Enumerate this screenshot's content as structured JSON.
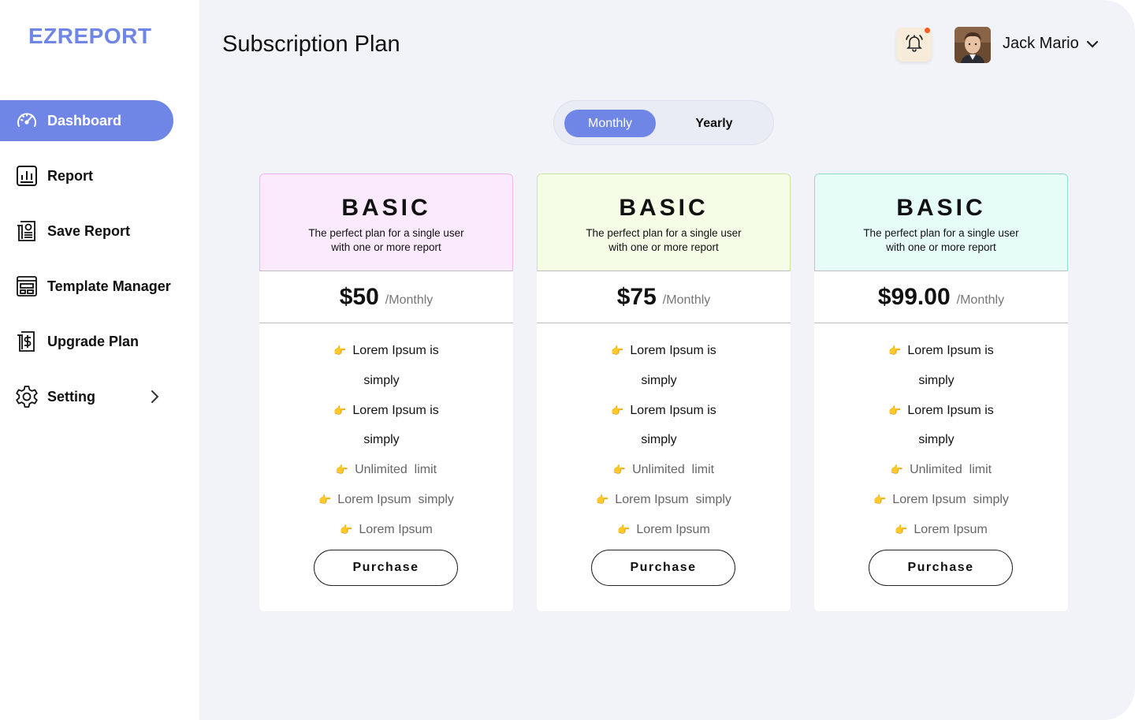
{
  "app": {
    "logo": "EZREPORT"
  },
  "sidebar": {
    "items": [
      {
        "label": "Dashboard",
        "icon": "speedometer-icon",
        "active": true
      },
      {
        "label": "Report",
        "icon": "bar-chart-icon",
        "active": false
      },
      {
        "label": "Save Report",
        "icon": "document-icon",
        "active": false
      },
      {
        "label": "Template Manager",
        "icon": "layout-icon",
        "active": false
      },
      {
        "label": "Upgrade Plan",
        "icon": "dollar-document-icon",
        "active": false
      },
      {
        "label": "Setting",
        "icon": "gear-icon",
        "active": false
      }
    ]
  },
  "header": {
    "title": "Subscription Plan",
    "user_name": "Jack Mario"
  },
  "billing_toggle": {
    "options": [
      "Monthly",
      "Yearly"
    ],
    "selected": "Monthly"
  },
  "plans": [
    {
      "name": "BASIC",
      "description": "The perfect plan for a single user with one or more report",
      "price": "$50",
      "period": "/Monthly",
      "header_bg": "#fbeafd",
      "header_border": "#e9b7ef",
      "features": [
        "Lorem Ipsum is",
        "simply",
        "Lorem Ipsum is",
        "simply",
        "Unlimited  limit",
        "Lorem Ipsum  simply",
        "Lorem Ipsum"
      ],
      "button": "Purchase"
    },
    {
      "name": "BASIC",
      "description": "The perfect plan for a single user with one or more report",
      "price": "$75",
      "period": "/Monthly",
      "header_bg": "#f6fde7",
      "header_border": "#c9e3a0",
      "features": [
        "Lorem Ipsum is",
        "simply",
        "Lorem Ipsum is",
        "simply",
        "Unlimited  limit",
        "Lorem Ipsum  simply",
        "Lorem Ipsum"
      ],
      "button": "Purchase"
    },
    {
      "name": "BASIC",
      "description": "The perfect plan for a single user with one or more report",
      "price": "$99.00",
      "period": "/Monthly",
      "header_bg": "#e6fcf7",
      "header_border": "#8fdcca",
      "features": [
        "Lorem Ipsum is",
        "simply",
        "Lorem Ipsum is",
        "simply",
        "Unlimited  limit",
        "Lorem Ipsum  simply",
        "Lorem Ipsum"
      ],
      "button": "Purchase"
    }
  ],
  "colors": {
    "accent": "#6f86e6",
    "notification_dot": "#ff5a1f",
    "bell_bg": "#f7ebd9"
  }
}
